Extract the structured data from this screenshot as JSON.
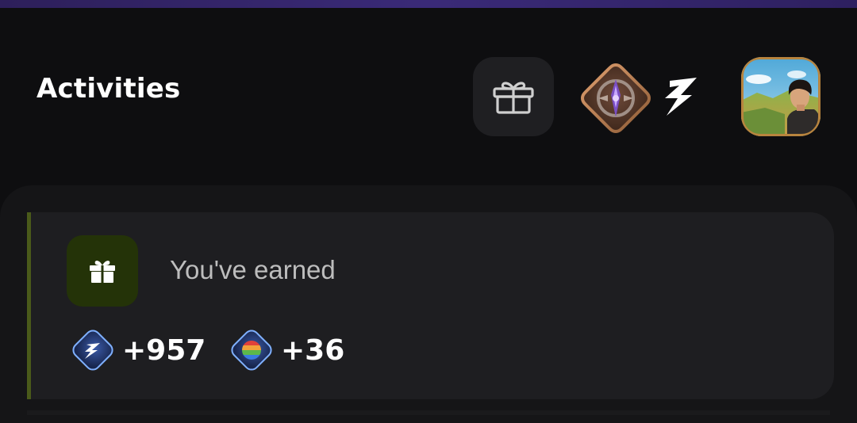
{
  "header": {
    "title": "Activities",
    "gift_icon": "gift-icon",
    "rank_icon": "rank-badge-icon",
    "brand_icon": "z-logo-icon",
    "avatar_icon": "user-avatar"
  },
  "activity_card": {
    "icon": "gift-icon",
    "text": "You've earned",
    "rewards": [
      {
        "icon": "z-token-icon",
        "amount": "+957"
      },
      {
        "icon": "rainbow-token-icon",
        "amount": "+36"
      }
    ]
  },
  "colors": {
    "background": "#0e0e10",
    "top_accent": "#3a2a78",
    "card_accent": "#4a5a1a",
    "icon_tile": "#243308",
    "avatar_border": "#b8843e"
  }
}
